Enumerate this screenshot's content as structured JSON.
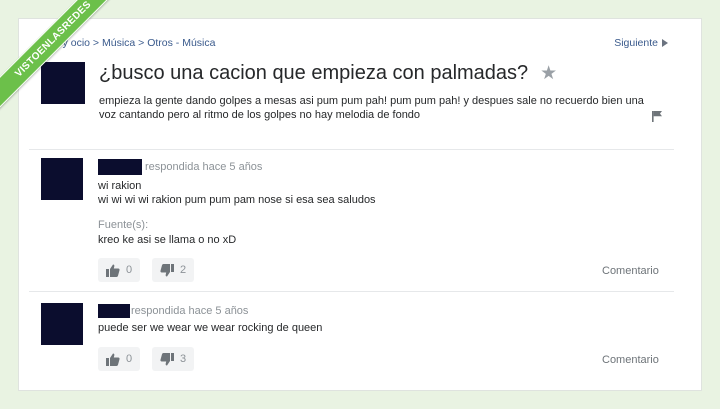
{
  "watermark": "VISTOENLASREDES",
  "breadcrumb": "Arte, cultura, música y ocio > Música > Otros - Música",
  "breadcrumb_visible": "sica y ocio > Música > Otros - Música",
  "next_label": "Siguiente",
  "question": {
    "title": "¿busco una cacion que empieza con palmadas?",
    "body": "empieza la gente dando golpes a mesas asi pum pum pah! pum pum pah! y despues sale no recuerdo bien una voz cantando pero al ritmo de los golpes no hay melodia de fondo"
  },
  "answers": [
    {
      "meta": "respondida hace 5 años",
      "lines": [
        "wi rakion",
        "wi wi wi wi rakion pum pum pam nose si esa sea saludos"
      ],
      "source_label": "Fuente(s):",
      "source_text": "kreo ke asi se llama o no xD",
      "upvotes": "0",
      "downvotes": "2",
      "comment_label": "Comentario"
    },
    {
      "meta": "respondida hace 5 años",
      "lines": [
        "puede ser we wear we wear rocking de queen"
      ],
      "upvotes": "0",
      "downvotes": "3",
      "comment_label": "Comentario"
    }
  ],
  "colors": {
    "background": "#e9f3e2",
    "link": "#3a5a8c",
    "redaction": "#0b0d2e",
    "watermark_green": "#6cc04a"
  },
  "icons": [
    "star-icon",
    "flag-icon",
    "thumbs-up-icon",
    "thumbs-down-icon",
    "chevron-right-icon"
  ]
}
